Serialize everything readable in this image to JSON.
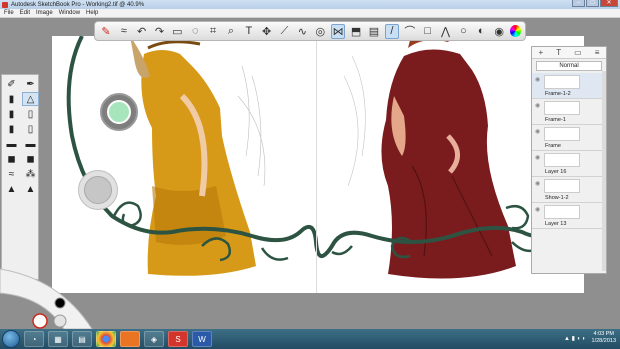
{
  "window": {
    "title": "Autodesk SketchBook Pro - Working2.tif @ 40.9%"
  },
  "menu": [
    "File",
    "Edit",
    "Image",
    "Window",
    "Help"
  ],
  "toolbar": {
    "items": [
      "brush-icon",
      "smudge-icon",
      "undo-icon",
      "redo-icon",
      "rect-select-icon",
      "lasso-icon",
      "crop-icon",
      "zoom-icon",
      "text-icon",
      "move-icon",
      "ruler-icon",
      "french-curve-icon",
      "ellipse-icon",
      "symmetry-icon",
      "fill-icon",
      "layer-icon",
      "copic-icon",
      "color-wheel-icon",
      "line-icon",
      "rect-icon",
      "curve-icon",
      "polyline-icon",
      "pressure-icon",
      "color-icon"
    ]
  },
  "layers": {
    "blend_mode": "Normal",
    "rows": [
      {
        "name": "Frame-1-2"
      },
      {
        "name": "Frame-1"
      },
      {
        "name": "Frame"
      },
      {
        "name": "Layer 16"
      },
      {
        "name": "Show-1-2"
      },
      {
        "name": "Layer 13"
      }
    ]
  },
  "taskbar": {
    "time": "4:03 PM",
    "date": "1/28/2013"
  },
  "colors": {
    "canvas": "#ffffff",
    "workspace": "#8f8f8f",
    "taskbar": "#2b5a70",
    "swatch": "#a7e5bc"
  }
}
